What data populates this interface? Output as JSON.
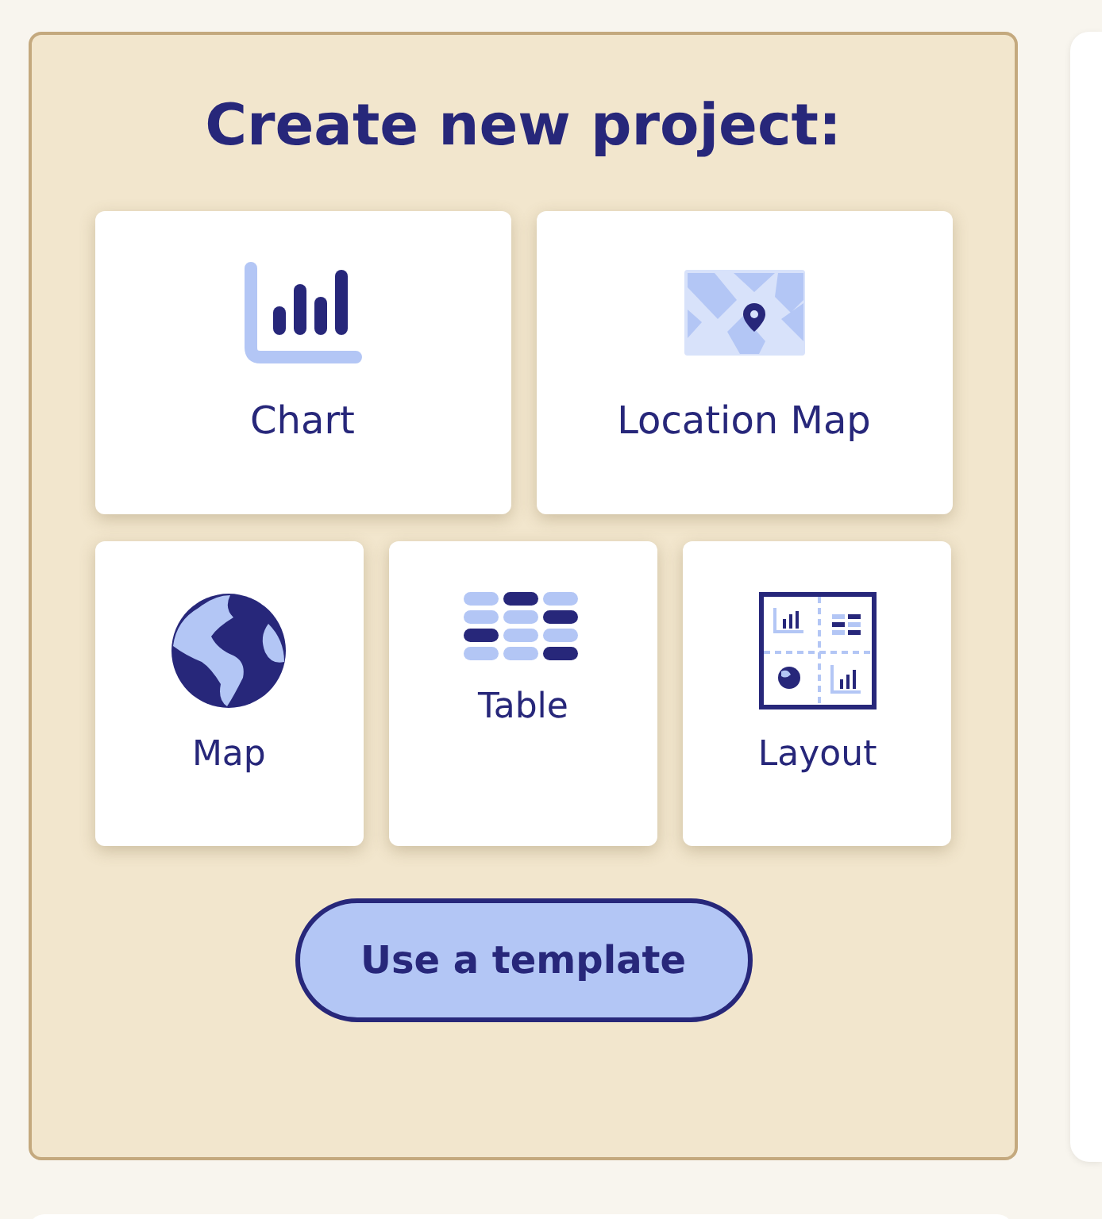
{
  "panel": {
    "title": "Create new project:",
    "tile_rows": [
      [
        {
          "kind": "chart",
          "label": "Chart"
        },
        {
          "kind": "location-map",
          "label": "Location Map"
        }
      ],
      [
        {
          "kind": "map",
          "label": "Map"
        },
        {
          "kind": "table",
          "label": "Table"
        },
        {
          "kind": "layout",
          "label": "Layout"
        }
      ]
    ],
    "template_button": "Use a template"
  }
}
